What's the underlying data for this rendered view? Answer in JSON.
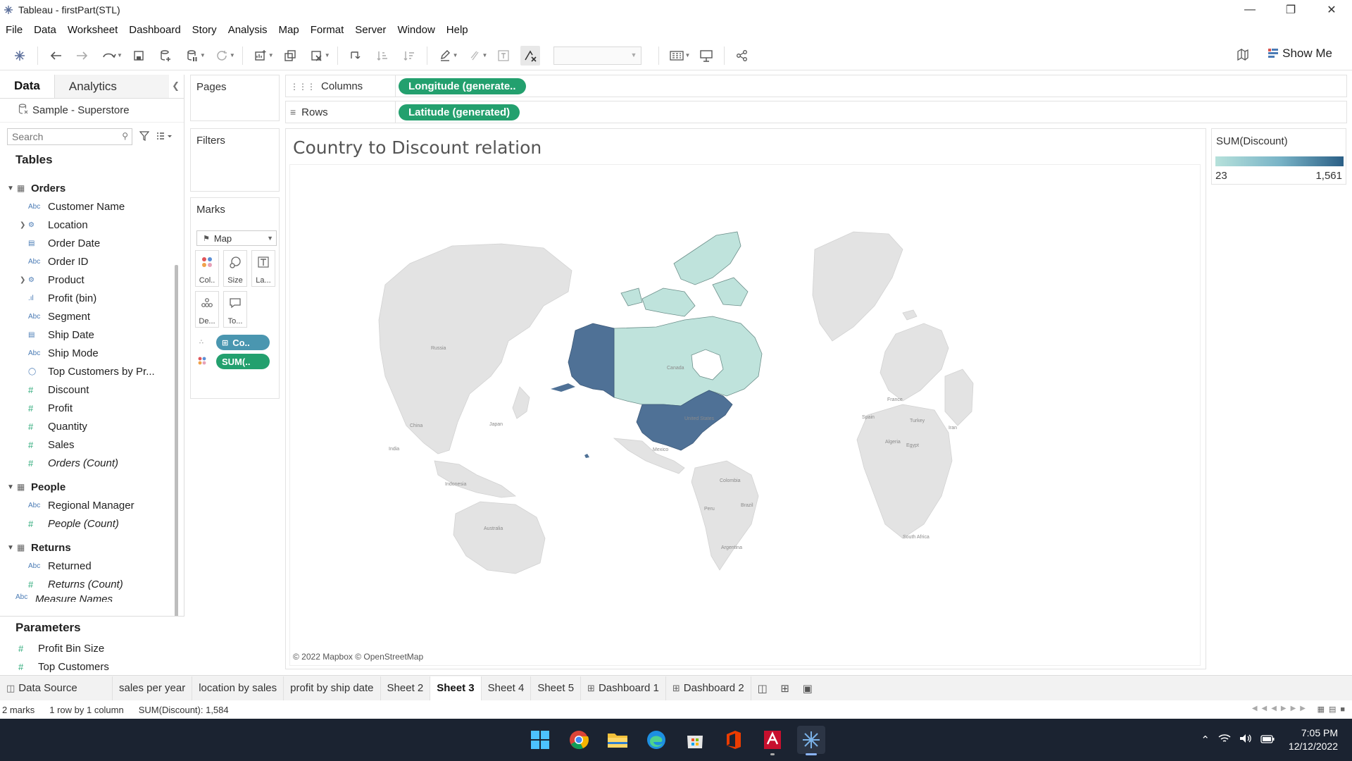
{
  "window": {
    "title": "Tableau - firstPart(STL)",
    "controls": [
      "minimize",
      "restore",
      "close"
    ]
  },
  "menu": [
    "File",
    "Data",
    "Worksheet",
    "Dashboard",
    "Story",
    "Analysis",
    "Map",
    "Format",
    "Server",
    "Window",
    "Help"
  ],
  "toolbar": {
    "show_me_label": "Show Me",
    "icons": [
      "tableau-logo-icon",
      "undo-icon",
      "redo-icon",
      "replay-icon",
      "save-icon",
      "new-datasource-icon",
      "pause-updates-icon",
      "refresh-icon",
      "new-worksheet-icon",
      "duplicate-icon",
      "clear-icon",
      "swap-icon",
      "sort-asc-icon",
      "sort-desc-icon",
      "highlight-icon",
      "group-icon",
      "labels-icon",
      "fix-axes-icon",
      "fit-dropdown",
      "presentation-icon",
      "share-icon",
      "show-labels-icon"
    ]
  },
  "data_pane": {
    "tabs": [
      {
        "label": "Data",
        "active": true
      },
      {
        "label": "Analytics",
        "active": false
      }
    ],
    "datasource": "Sample - Superstore",
    "search_placeholder": "Search",
    "tables_header": "Tables",
    "groups": [
      {
        "name": "Orders",
        "fields": [
          {
            "icon": "Abc",
            "label": "Customer Name",
            "kind": "dimension"
          },
          {
            "icon": "hierarchy",
            "label": "Location",
            "kind": "hierarchy"
          },
          {
            "icon": "date",
            "label": "Order Date",
            "kind": "date"
          },
          {
            "icon": "Abc",
            "label": "Order ID",
            "kind": "dimension"
          },
          {
            "icon": "hierarchy",
            "label": "Product",
            "kind": "hierarchy"
          },
          {
            "icon": "bin",
            "label": "Profit (bin)",
            "kind": "bin"
          },
          {
            "icon": "Abc",
            "label": "Segment",
            "kind": "dimension"
          },
          {
            "icon": "date",
            "label": "Ship Date",
            "kind": "date"
          },
          {
            "icon": "Abc",
            "label": "Ship Mode",
            "kind": "dimension"
          },
          {
            "icon": "set",
            "label": "Top Customers by Pr...",
            "kind": "set"
          },
          {
            "icon": "#",
            "label": "Discount",
            "kind": "measure"
          },
          {
            "icon": "#",
            "label": "Profit",
            "kind": "measure"
          },
          {
            "icon": "#",
            "label": "Quantity",
            "kind": "measure"
          },
          {
            "icon": "#",
            "label": "Sales",
            "kind": "measure"
          },
          {
            "icon": "#",
            "label": "Orders (Count)",
            "kind": "measure",
            "italic": true
          }
        ]
      },
      {
        "name": "People",
        "fields": [
          {
            "icon": "Abc",
            "label": "Regional Manager",
            "kind": "dimension"
          },
          {
            "icon": "#",
            "label": "People (Count)",
            "kind": "measure",
            "italic": true
          }
        ]
      },
      {
        "name": "Returns",
        "fields": [
          {
            "icon": "Abc",
            "label": "Returned",
            "kind": "dimension"
          },
          {
            "icon": "#",
            "label": "Returns (Count)",
            "kind": "measure",
            "italic": true
          }
        ]
      }
    ],
    "cut_off_field": "Measure Names",
    "parameters_header": "Parameters",
    "parameters": [
      "Profit Bin Size",
      "Top Customers"
    ]
  },
  "cards": {
    "pages": "Pages",
    "filters": "Filters",
    "marks": "Marks",
    "mark_type": "Map",
    "mark_buttons": [
      "Col..",
      "Size",
      "La...",
      "De...",
      "To..."
    ],
    "mark_pills": [
      "Co..",
      "SUM(.."
    ]
  },
  "shelves": {
    "columns_label": "Columns",
    "columns_pill": "Longitude (generate..",
    "rows_label": "Rows",
    "rows_pill": "Latitude (generated)"
  },
  "viz": {
    "title": "Country to Discount relation",
    "attribution": "© 2022 Mapbox © OpenStreetMap",
    "map_labels": [
      "Russia",
      "China",
      "Japan",
      "India",
      "Indonesia",
      "Australia",
      "Canada",
      "United States",
      "Mexico",
      "Colombia",
      "Peru",
      "Brazil",
      "Argentina",
      "France",
      "Spain",
      "Turkey",
      "Iran",
      "Algeria",
      "Egypt",
      "South Africa"
    ],
    "highlighted": [
      {
        "country": "United States",
        "color": "#4f7196"
      },
      {
        "country": "Alaska (United States)",
        "color": "#4f7196"
      },
      {
        "country": "Canada",
        "color": "#bfe3dc"
      }
    ]
  },
  "legend": {
    "title": "SUM(Discount)",
    "min": "23",
    "max": "1,561",
    "color_low": "#b6e1db",
    "color_high": "#2b5f86"
  },
  "sheet_tabs": [
    {
      "label": "Data Source",
      "icon": "datasource-icon"
    },
    {
      "label": "sales per year"
    },
    {
      "label": "location by sales"
    },
    {
      "label": "profit by ship date"
    },
    {
      "label": "Sheet 2"
    },
    {
      "label": "Sheet 3",
      "active": true
    },
    {
      "label": "Sheet 4"
    },
    {
      "label": "Sheet 5"
    },
    {
      "label": "Dashboard 1",
      "icon": "dashboard-icon"
    },
    {
      "label": "Dashboard 2",
      "icon": "dashboard-icon"
    }
  ],
  "status": {
    "marks": "2 marks",
    "layout": "1 row by 1 column",
    "sum": "SUM(Discount): 1,584"
  },
  "taskbar": {
    "apps": [
      "windows-start-icon",
      "chrome-icon",
      "file-explorer-icon",
      "edge-icon",
      "microsoft-store-icon",
      "office-icon",
      "autocad-icon",
      "tableau-icon"
    ],
    "time": "7:05 PM",
    "date": "12/12/2022"
  }
}
